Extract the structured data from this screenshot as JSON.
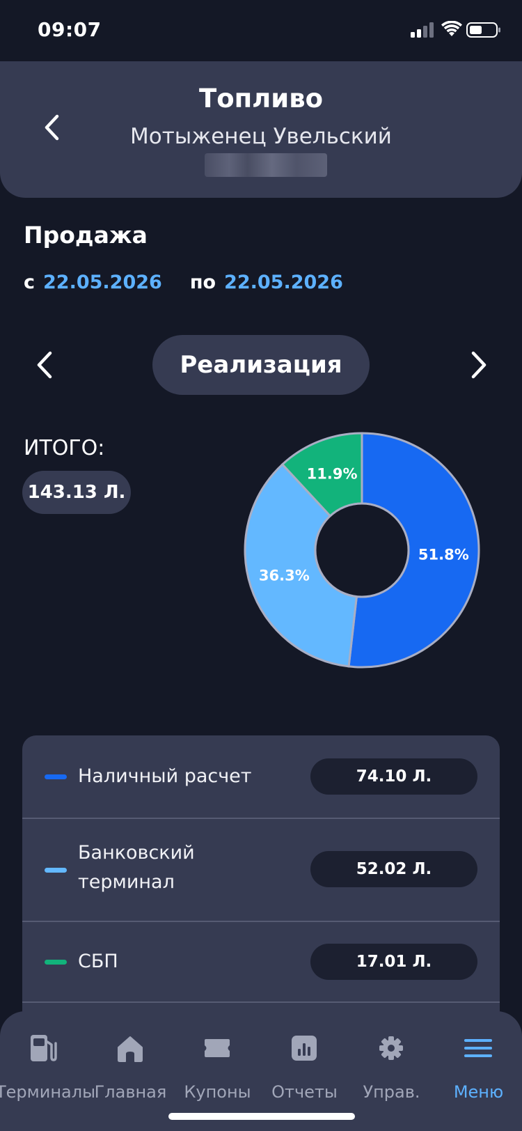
{
  "status": {
    "time": "09:07"
  },
  "header": {
    "title": "Топливо",
    "subtitle": "Мотыженец Увельский"
  },
  "section": {
    "title": "Продажа",
    "from_label": "с",
    "from_date": "22.05.2026",
    "to_label": "по",
    "to_date": "22.05.2026"
  },
  "mode": {
    "label": "Реализация"
  },
  "total": {
    "label": "ИТОГО:",
    "value": "143.13 Л."
  },
  "colors": {
    "cash": "#1769f2",
    "card": "#63b8ff",
    "sbp": "#12b37b",
    "accent": "#5db1ff",
    "background": "#141826",
    "panel": "#363b52"
  },
  "chart_data": {
    "type": "pie",
    "donut": true,
    "categories": [
      "Наличный расчет",
      "Банковский терминал",
      "СБП"
    ],
    "values": [
      51.8,
      36.3,
      11.9
    ],
    "labels": [
      "51.8%",
      "36.3%",
      "11.9%"
    ]
  },
  "legend": [
    {
      "name": "Наличный расчет",
      "value": "74.10 Л.",
      "color": "#1769f2"
    },
    {
      "name_line1": "Банковский",
      "name_line2": "терминал",
      "value": "52.02 Л.",
      "color": "#63b8ff"
    },
    {
      "name": "СБП",
      "value": "17.01 Л.",
      "color": "#12b37b"
    }
  ],
  "tabs": [
    {
      "label": "Терминалы",
      "icon": "fuel-pump-icon"
    },
    {
      "label": "Главная",
      "icon": "home-icon"
    },
    {
      "label": "Купоны",
      "icon": "coupon-icon"
    },
    {
      "label": "Отчеты",
      "icon": "report-chart-icon"
    },
    {
      "label": "Управ.",
      "icon": "gear-icon"
    },
    {
      "label": "Меню",
      "icon": "menu-icon",
      "active": true
    }
  ]
}
